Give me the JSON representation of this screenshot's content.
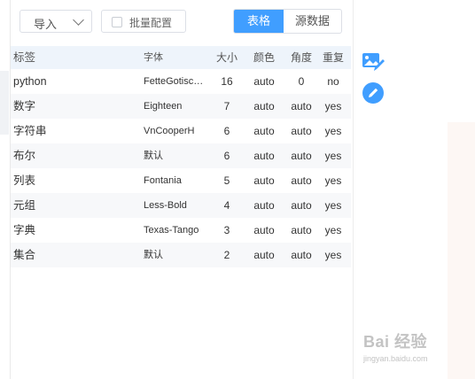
{
  "toolbar": {
    "import_label": "导入",
    "batch_label": "批量配置",
    "tabs": [
      {
        "label": "表格",
        "active": true
      },
      {
        "label": "源数据",
        "active": false
      }
    ]
  },
  "colors": {
    "accent": "#409eff",
    "header_bg": "#eef4fb",
    "row_alt": "#f7f8fa"
  },
  "table": {
    "headers": {
      "label": "标签",
      "font": "字体",
      "size": "大小",
      "color": "颜色",
      "angle": "角度",
      "repeat": "重复"
    },
    "rows": [
      {
        "label": "python",
        "font": "FetteGotisc…",
        "size": "16",
        "color": "auto",
        "angle": "0",
        "repeat": "no"
      },
      {
        "label": "数字",
        "font": "Eighteen",
        "size": "7",
        "color": "auto",
        "angle": "auto",
        "repeat": "yes"
      },
      {
        "label": "字符串",
        "font": "VnCooperH",
        "size": "6",
        "color": "auto",
        "angle": "auto",
        "repeat": "yes"
      },
      {
        "label": "布尔",
        "font": "默认",
        "size": "6",
        "color": "auto",
        "angle": "auto",
        "repeat": "yes"
      },
      {
        "label": "列表",
        "font": "Fontania",
        "size": "5",
        "color": "auto",
        "angle": "auto",
        "repeat": "yes"
      },
      {
        "label": "元组",
        "font": "Less-Bold",
        "size": "4",
        "color": "auto",
        "angle": "auto",
        "repeat": "yes"
      },
      {
        "label": "字典",
        "font": "Texas-Tango",
        "size": "3",
        "color": "auto",
        "angle": "auto",
        "repeat": "yes"
      },
      {
        "label": "集合",
        "font": "默认",
        "size": "2",
        "color": "auto",
        "angle": "auto",
        "repeat": "yes"
      }
    ]
  },
  "side_icons": [
    "image-edit-icon",
    "edit-circle-icon"
  ],
  "watermark": {
    "main": "Bai 经验",
    "sub": "jingyan.baidu.com"
  }
}
